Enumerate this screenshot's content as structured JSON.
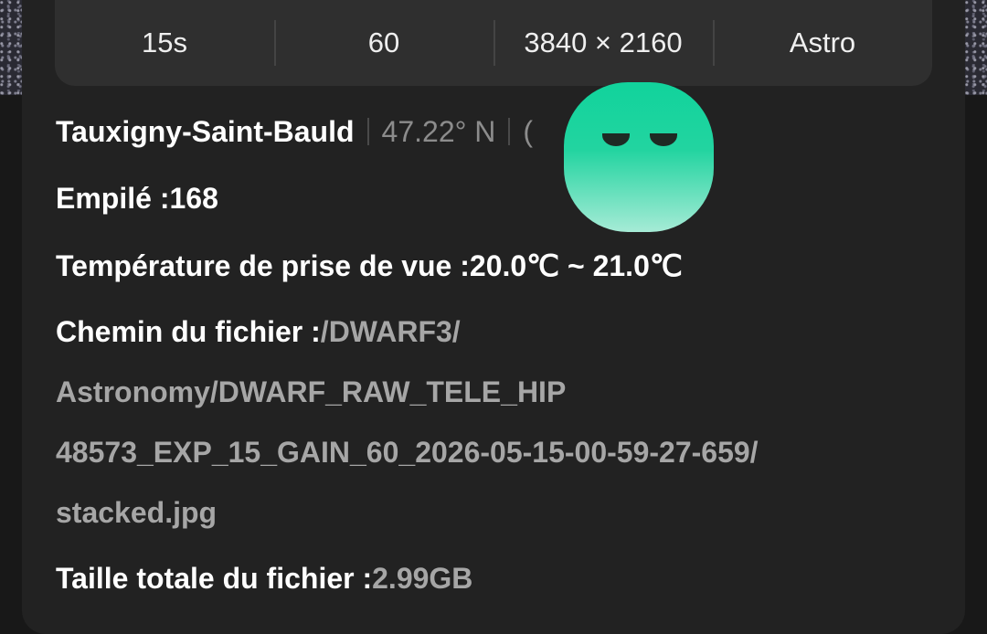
{
  "params": {
    "exposure": "15s",
    "gain": "60",
    "resolution": "3840 × 2160",
    "mode": "Astro"
  },
  "location": {
    "name": "Tauxigny-Saint-Bauld",
    "latitude": "47.22° N",
    "longitude_partial": "("
  },
  "stacked": {
    "label": "Empilé :",
    "value": "168"
  },
  "temperature": {
    "label": "Température de prise de vue :",
    "value": "20.0℃ ~ 21.0℃"
  },
  "filepath": {
    "label": "Chemin du fichier :",
    "line1": "/DWARF3/",
    "line2": "Astronomy/DWARF_RAW_TELE_HIP",
    "line3": "48573_EXP_15_GAIN_60_2026-05-15-00-59-27-659/",
    "line4": "stacked.jpg"
  },
  "filesize": {
    "label": "Taille totale du fichier :",
    "value": "2.99GB"
  },
  "colors": {
    "mascot_top": "#11d39c",
    "mascot_bottom": "#a6ebd6"
  }
}
